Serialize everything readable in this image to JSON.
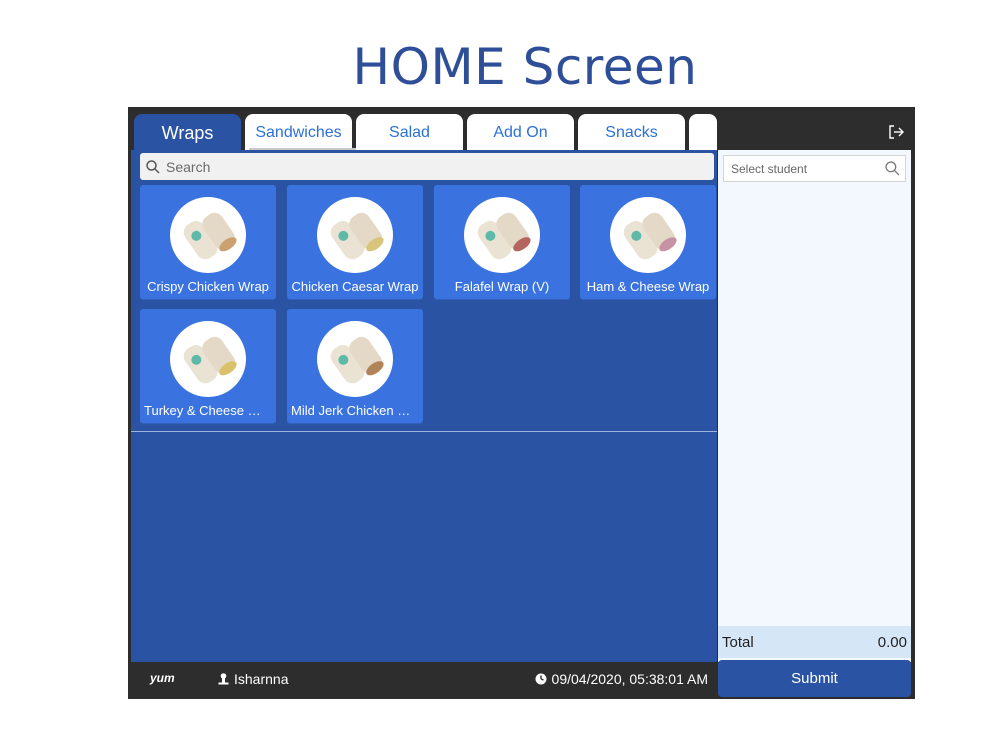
{
  "page": {
    "title": "HOME Screen"
  },
  "tabs": [
    {
      "label": "Wraps",
      "active": true
    },
    {
      "label": "Sandwiches",
      "active": false
    },
    {
      "label": "Salad",
      "active": false
    },
    {
      "label": "Add On",
      "active": false
    },
    {
      "label": "Snacks",
      "active": false
    },
    {
      "label": "",
      "active": false
    }
  ],
  "search": {
    "placeholder": "Search"
  },
  "products": [
    {
      "name": "Crispy Chicken Wrap",
      "filling": "#caa16f"
    },
    {
      "name": "Chicken Caesar Wrap",
      "filling": "#d8c47a"
    },
    {
      "name": "Falafel Wrap (V)",
      "filling": "#b4655c"
    },
    {
      "name": "Ham & Cheese Wrap",
      "filling": "#c792a3"
    },
    {
      "name": "Turkey & Cheese Wrap",
      "filling": "#d9c26a"
    },
    {
      "name": "Mild Jerk Chicken Wrap",
      "filling": "#b0835a"
    }
  ],
  "order": {
    "student_placeholder": "Select student",
    "total_label": "Total",
    "total_value": "0.00",
    "submit_label": "Submit"
  },
  "footer": {
    "logo": "yum",
    "user": "Isharnna",
    "datetime": "09/04/2020, 05:38:01 AM"
  },
  "colors": {
    "accent": "#2a53a3",
    "tile": "#3a73df",
    "frame": "#2d2d2d",
    "title": "#2e4f98"
  }
}
